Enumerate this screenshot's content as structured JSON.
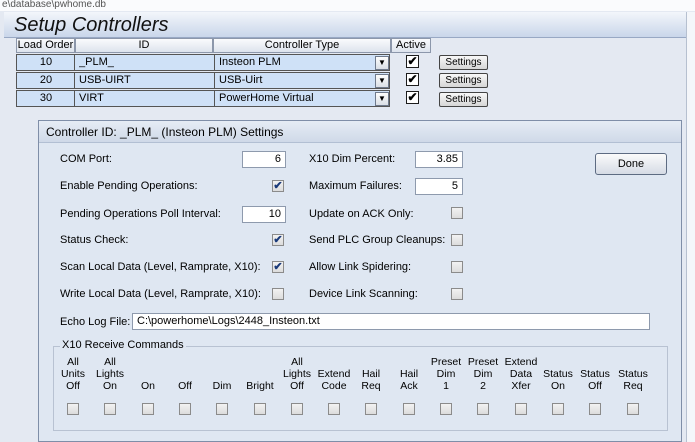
{
  "path_fragment": "e\\database\\pwhome.db",
  "window_title": "Setup Controllers",
  "table": {
    "columns": [
      "Load Order",
      "ID",
      "Controller Type",
      "Active"
    ],
    "rows": [
      {
        "load_order": "10",
        "id": "_PLM_",
        "type": "Insteon PLM",
        "active": "✔",
        "settings": "Settings"
      },
      {
        "load_order": "20",
        "id": "USB-UIRT",
        "type": "USB-Uirt",
        "active": "✔",
        "settings": "Settings"
      },
      {
        "load_order": "30",
        "id": "VIRT",
        "type": "PowerHome Virtual",
        "active": "✔",
        "settings": "Settings"
      }
    ]
  },
  "dialog": {
    "title": "Controller ID: _PLM_ (Insteon PLM) Settings",
    "done_label": "Done",
    "com_port": {
      "label": "COM Port:",
      "value": "6"
    },
    "x10_dim": {
      "label": "X10 Dim Percent:",
      "value": "3.85"
    },
    "enable_pending": {
      "label": "Enable Pending Operations:",
      "checked": true
    },
    "max_failures": {
      "label": "Maximum Failures:",
      "value": "5"
    },
    "poll_interval": {
      "label": "Pending Operations Poll Interval:",
      "value": "10"
    },
    "update_ack": {
      "label": "Update on ACK Only:",
      "checked": false
    },
    "status_check": {
      "label": "Status Check:",
      "checked": true
    },
    "plc_cleanups": {
      "label": "Send PLC Group Cleanups:",
      "checked": false
    },
    "scan_local": {
      "label": "Scan Local Data (Level, Ramprate, X10):",
      "checked": true
    },
    "link_spider": {
      "label": "Allow Link Spidering:",
      "checked": false
    },
    "write_local": {
      "label": "Write Local Data (Level, Ramprate, X10):",
      "checked": false
    },
    "device_link": {
      "label": "Device Link Scanning:",
      "checked": false
    },
    "echo_log": {
      "label": "Echo Log File:",
      "value": "C:\\powerhome\\Logs\\2448_Insteon.txt"
    },
    "x10_group_label": "X10 Receive Commands",
    "x10_commands": [
      [
        "All",
        "Units",
        "Off"
      ],
      [
        "All",
        "Lights",
        "On"
      ],
      [
        "On"
      ],
      [
        "Off"
      ],
      [
        "Dim"
      ],
      [
        "Bright"
      ],
      [
        "All",
        "Lights",
        "Off"
      ],
      [
        "Extend",
        "Code"
      ],
      [
        "Hail",
        "Req"
      ],
      [
        "Hail",
        "Ack"
      ],
      [
        "Preset",
        "Dim",
        "1"
      ],
      [
        "Preset",
        "Dim",
        "2"
      ],
      [
        "Extend",
        "Data",
        "Xfer"
      ],
      [
        "Status",
        "On"
      ],
      [
        "Status",
        "Off"
      ],
      [
        "Status",
        "Req"
      ]
    ]
  }
}
